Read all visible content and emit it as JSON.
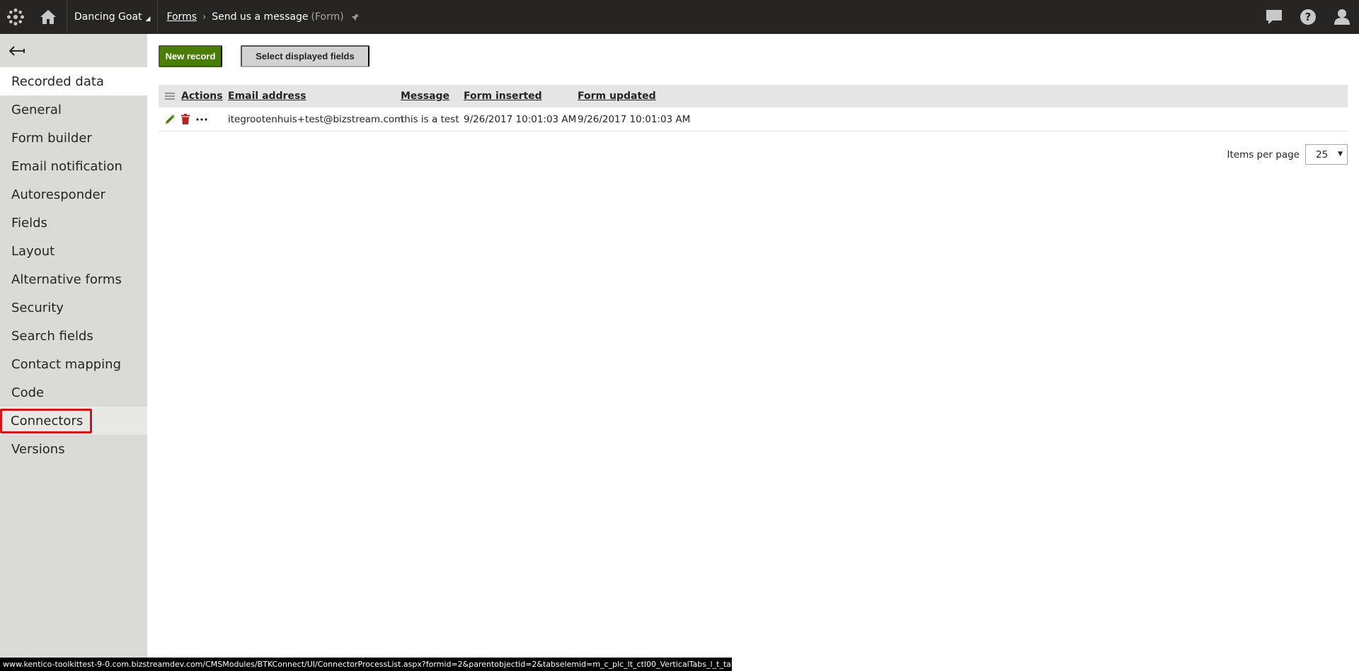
{
  "header": {
    "site_name": "Dancing Goat",
    "breadcrumb": {
      "root": "Forms",
      "current": "Send us a message",
      "type": "(Form)"
    }
  },
  "sidebar": {
    "items": [
      {
        "label": "Recorded data"
      },
      {
        "label": "General"
      },
      {
        "label": "Form builder"
      },
      {
        "label": "Email notification"
      },
      {
        "label": "Autoresponder"
      },
      {
        "label": "Fields"
      },
      {
        "label": "Layout"
      },
      {
        "label": "Alternative forms"
      },
      {
        "label": "Security"
      },
      {
        "label": "Search fields"
      },
      {
        "label": "Contact mapping"
      },
      {
        "label": "Code"
      },
      {
        "label": "Connectors"
      },
      {
        "label": "Versions"
      }
    ]
  },
  "toolbar": {
    "new_record": "New record",
    "select_fields": "Select displayed fields"
  },
  "grid": {
    "columns": [
      "Actions",
      "Email address",
      "Message",
      "Form inserted",
      "Form updated"
    ],
    "rows": [
      {
        "email": "itegrootenhuis+test@bizstream.com",
        "message": "this is a test",
        "inserted": "9/26/2017 10:01:03 AM",
        "updated": "9/26/2017 10:01:03 AM"
      }
    ]
  },
  "pager": {
    "label": "Items per page",
    "value": "25"
  },
  "statusbar": {
    "url": "www.kentico-toolkittest-9-0.com.bizstreamdev.com/CMSModules/BTKConnect/UI/ConnectorProcessList.aspx?formid=2&parentobjectid=2&tabselemid=m_c_plc_lt_ctl00_VerticalTabs_l_t_tabsElem"
  },
  "colors": {
    "header_bg": "#262524",
    "sidebar_bg": "#dadbd7",
    "primary": "#497d04",
    "highlight": "#d4141a",
    "delete": "#b12628"
  }
}
